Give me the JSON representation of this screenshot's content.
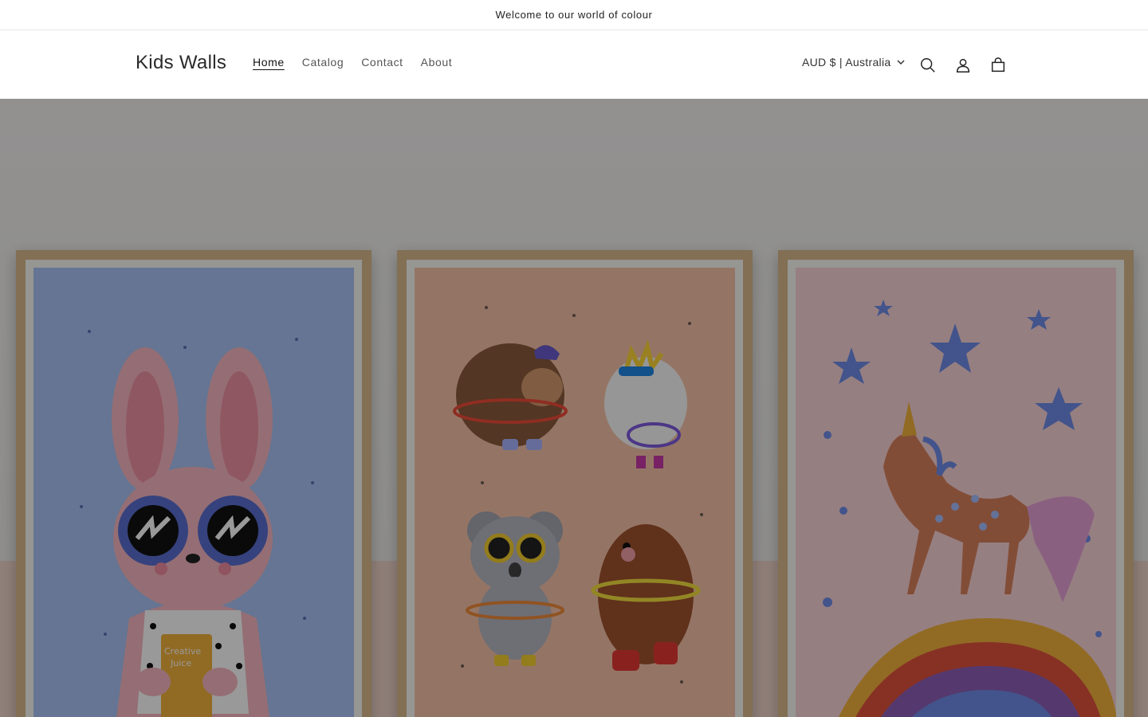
{
  "announcement": {
    "text": "Welcome to our world of colour"
  },
  "header": {
    "logo": "Kids Walls",
    "nav": [
      {
        "label": "Home",
        "active": true
      },
      {
        "label": "Catalog",
        "active": false
      },
      {
        "label": "Contact",
        "active": false
      },
      {
        "label": "About",
        "active": false
      }
    ],
    "country_selector": "AUD $ | Australia",
    "icons": [
      "search-icon",
      "account-icon",
      "cart-icon"
    ]
  },
  "hero": {
    "colors": {
      "overlay": "#000000",
      "frame": "#d9b98c",
      "bunny_bg": "#a9c4f5",
      "animals_bg": "#f7c3a8",
      "unicorn_bg": "#fbd4d8"
    },
    "juice_text": [
      "Creative",
      "Juice"
    ]
  }
}
